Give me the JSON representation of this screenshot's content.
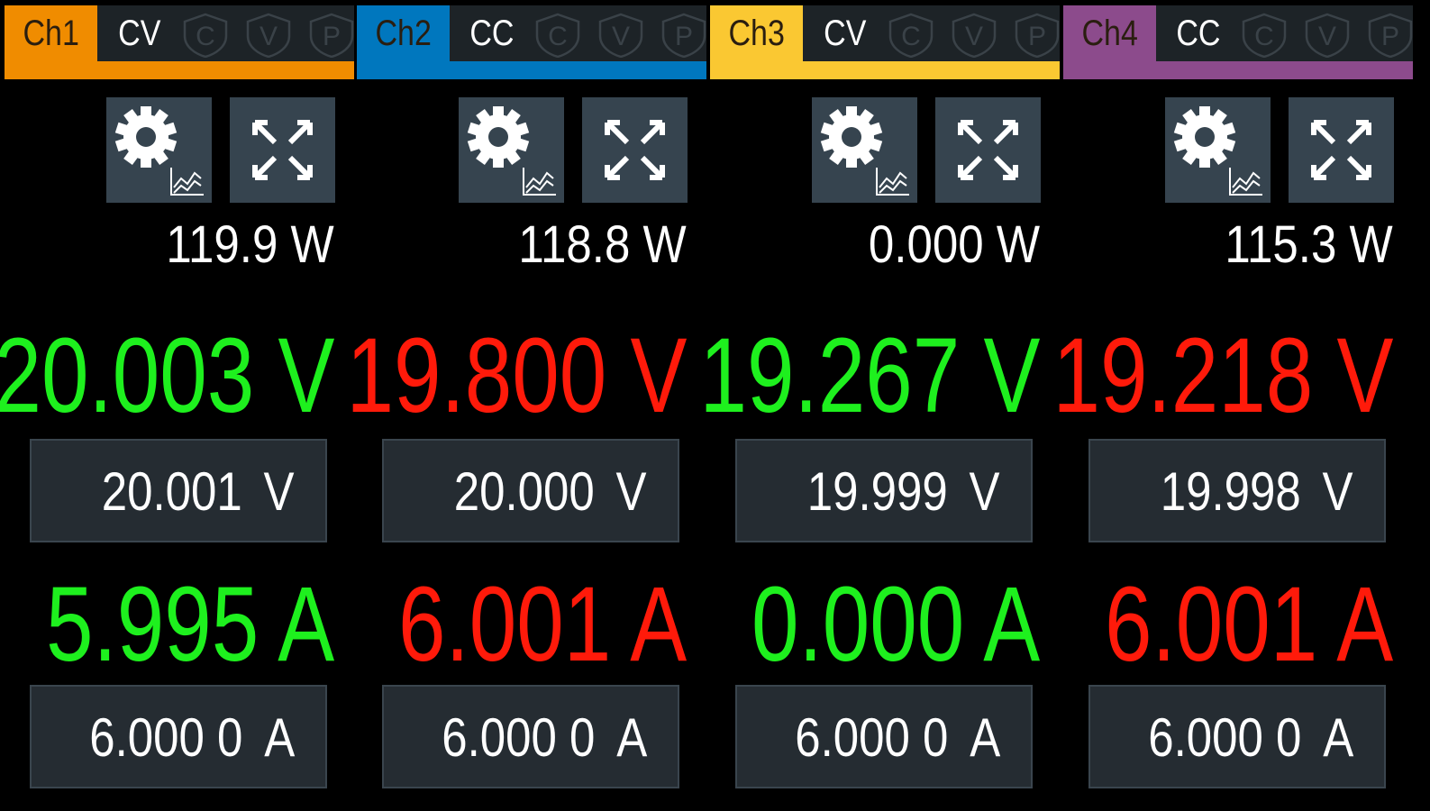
{
  "colors": {
    "green": "#1ef01e",
    "red": "#ff1a0a"
  },
  "channels": [
    {
      "label": "Ch1",
      "mode": "CV",
      "color": "#f08c00",
      "power": "119.9 W",
      "voltage": "20.003 V",
      "voltage_state": "green",
      "voltage_set": "20.001",
      "voltage_unit": "V",
      "current": "5.995 A",
      "current_state": "green",
      "current_set": "6.000 0",
      "current_unit": "A",
      "protections": [
        "C",
        "V",
        "P"
      ]
    },
    {
      "label": "Ch2",
      "mode": "CC",
      "color": "#0077be",
      "power": "118.8 W",
      "voltage": "19.800 V",
      "voltage_state": "red",
      "voltage_set": "20.000",
      "voltage_unit": "V",
      "current": "6.001 A",
      "current_state": "red",
      "current_set": "6.000 0",
      "current_unit": "A",
      "protections": [
        "C",
        "V",
        "P"
      ]
    },
    {
      "label": "Ch3",
      "mode": "CV",
      "color": "#fac832",
      "power": "0.000 W",
      "voltage": "19.267 V",
      "voltage_state": "green",
      "voltage_set": "19.999",
      "voltage_unit": "V",
      "current": "0.000 A",
      "current_state": "green",
      "current_set": "6.000 0",
      "current_unit": "A",
      "protections": [
        "C",
        "V",
        "P"
      ]
    },
    {
      "label": "Ch4",
      "mode": "CC",
      "color": "#8c4b8c",
      "power": "115.3 W",
      "voltage": "19.218 V",
      "voltage_state": "red",
      "voltage_set": "19.998",
      "voltage_unit": "V",
      "current": "6.001 A",
      "current_state": "red",
      "current_set": "6.000 0",
      "current_unit": "A",
      "protections": [
        "C",
        "V",
        "P"
      ]
    }
  ]
}
